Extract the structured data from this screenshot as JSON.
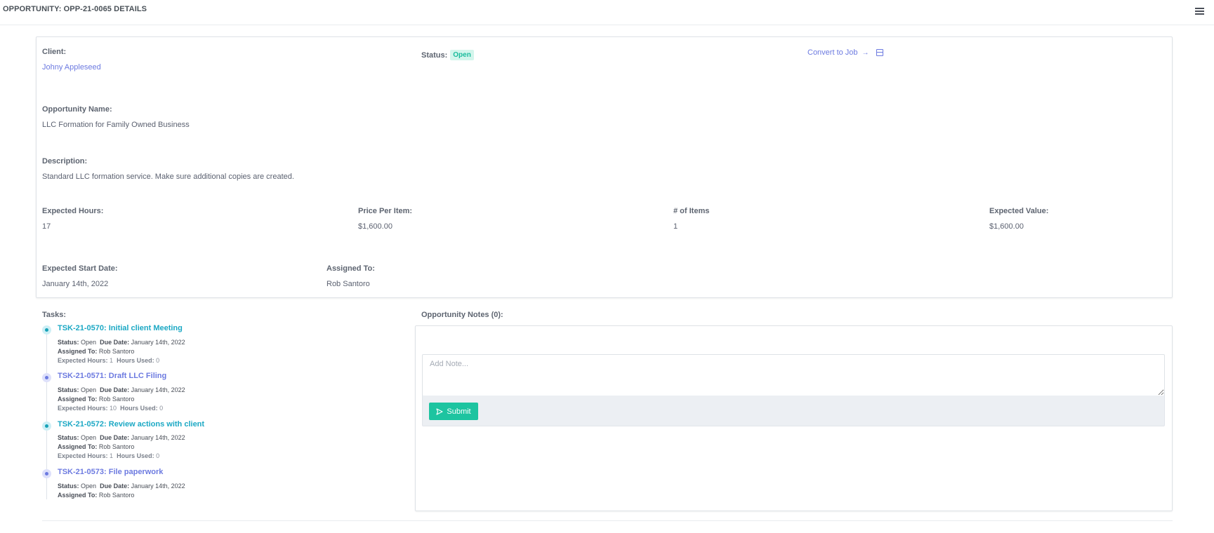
{
  "page": {
    "title": "OPPORTUNITY: OPP-21-0065 DETAILS"
  },
  "details": {
    "client": {
      "label": "Client:",
      "value": "Johny Appleseed"
    },
    "status": {
      "label": "Status:",
      "value": "Open"
    },
    "convert_label": "Convert to Job",
    "convert_arrow": "→",
    "opportunity_name": {
      "label": "Opportunity Name:",
      "value": "LLC Formation for Family Owned Business"
    },
    "description": {
      "label": "Description:",
      "value": "Standard LLC formation service. Make sure additional copies are created."
    },
    "expected_hours": {
      "label": "Expected Hours:",
      "value": "17"
    },
    "price_per_item": {
      "label": "Price Per Item:",
      "value": "$1,600.00"
    },
    "num_items": {
      "label": "# of Items",
      "value": "1"
    },
    "expected_value": {
      "label": "Expected Value:",
      "value": "$1,600.00"
    },
    "expected_start_date": {
      "label": "Expected Start Date:",
      "value": "January 14th, 2022"
    },
    "assigned_to": {
      "label": "Assigned To:",
      "value": "Rob Santoro"
    }
  },
  "tasks": {
    "label": "Tasks:",
    "field_labels": {
      "status": "Status:",
      "due_date": "Due Date:",
      "assigned_to": "Assigned To:",
      "expected_hours": "Expected Hours:",
      "hours_used": "Hours Used:"
    },
    "items": [
      {
        "title": "TSK-21-0570: Initial client Meeting",
        "status": "Open",
        "due_date": "January 14th, 2022",
        "assigned_to": "Rob Santoro",
        "expected_hours": "1",
        "hours_used": "0",
        "color": "#1ba8c4"
      },
      {
        "title": "TSK-21-0571: Draft LLC Filing",
        "status": "Open",
        "due_date": "January 14th, 2022",
        "assigned_to": "Rob Santoro",
        "expected_hours": "10",
        "hours_used": "0",
        "color": "#6c7ae0"
      },
      {
        "title": "TSK-21-0572: Review actions with client",
        "status": "Open",
        "due_date": "January 14th, 2022",
        "assigned_to": "Rob Santoro",
        "expected_hours": "1",
        "hours_used": "0",
        "color": "#1ba8c4"
      },
      {
        "title": "TSK-21-0573: File paperwork",
        "status": "Open",
        "due_date": "January 14th, 2022",
        "assigned_to": "Rob Santoro",
        "color": "#6c7ae0"
      }
    ]
  },
  "notes": {
    "label": "Opportunity Notes (0):",
    "placeholder": "Add Note...",
    "submit_label": "Submit"
  },
  "icons": {
    "menu": "hamburger-menu-icon",
    "convert_arrow": "arrow-right-icon",
    "calendar": "calendar-icon",
    "task_dot": "timeline-dot-icon",
    "send": "send-icon"
  },
  "colors": {
    "link": "#6c7ae0",
    "task_teal": "#1ba8c4",
    "badge_text": "#1abc9c",
    "badge_bg": "#d3f5ec",
    "submit_bg": "#1dc4a0"
  }
}
